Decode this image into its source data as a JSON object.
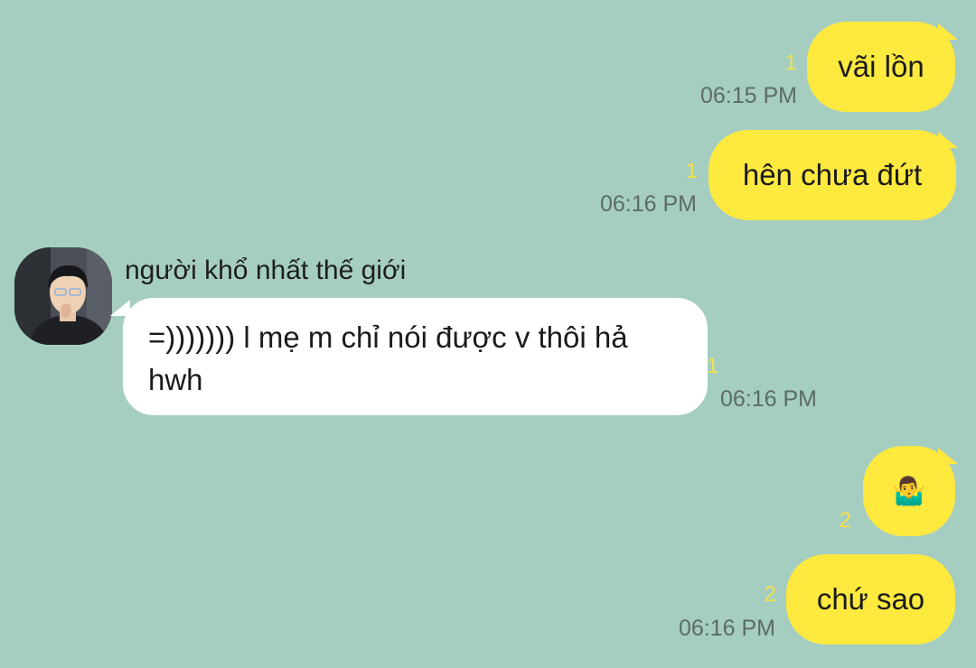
{
  "colors": {
    "background": "#a5cec1",
    "outgoing_bubble": "#fee93f",
    "incoming_bubble": "#ffffff",
    "unread_count": "#f4e04c",
    "timestamp": "#5d6b66"
  },
  "messages": [
    {
      "direction": "outgoing",
      "text": "vãi lồn",
      "unread": "1",
      "time": "06:15 PM"
    },
    {
      "direction": "outgoing",
      "text": "hên chưa đứt",
      "unread": "1",
      "time": "06:16 PM"
    },
    {
      "direction": "incoming",
      "sender": "người khổ nhất thế giới",
      "avatar_icon": "profile-photo",
      "text": "=))))))) l mẹ m chỉ nói được v thôi hả hwh",
      "unread": "1",
      "time": "06:16 PM"
    },
    {
      "direction": "outgoing",
      "text": "🤷‍♂️",
      "icon": "man-shrugging-emoji",
      "unread": "2",
      "time": ""
    },
    {
      "direction": "outgoing",
      "text": "chứ sao",
      "unread": "2",
      "time": "06:16 PM"
    }
  ]
}
